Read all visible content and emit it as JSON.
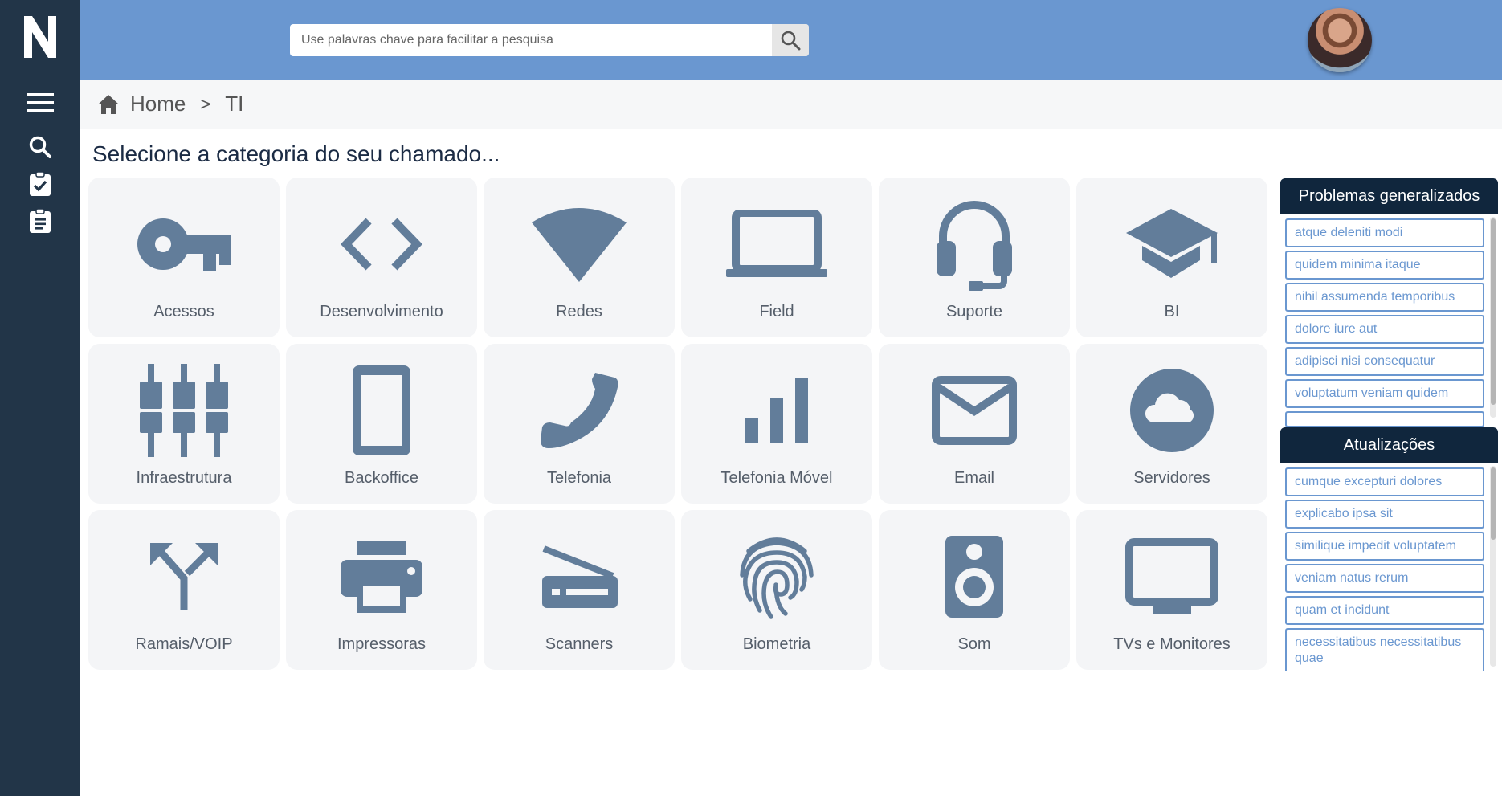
{
  "app": {
    "logo_letter": "N"
  },
  "sidebar": {
    "icons": [
      "menu-icon",
      "search-icon",
      "checklist-icon",
      "clipboard-icon"
    ]
  },
  "search": {
    "placeholder": "Use palavras chave para facilitar a pesquisa",
    "value": ""
  },
  "breadcrumb": {
    "home": "Home",
    "separator": ">",
    "current": "TI"
  },
  "page": {
    "title": "Selecione a categoria do seu chamado..."
  },
  "categories": [
    {
      "label": "Acessos",
      "icon": "key-icon"
    },
    {
      "label": "Desenvolvimento",
      "icon": "code-icon"
    },
    {
      "label": "Redes",
      "icon": "wifi-icon"
    },
    {
      "label": "Field",
      "icon": "laptop-icon"
    },
    {
      "label": "Suporte",
      "icon": "headset-icon"
    },
    {
      "label": "BI",
      "icon": "graduation-cap-icon"
    },
    {
      "label": "Infraestrutura",
      "icon": "plugs-icon"
    },
    {
      "label": "Backoffice",
      "icon": "tablet-icon"
    },
    {
      "label": "Telefonia",
      "icon": "phone-icon"
    },
    {
      "label": "Telefonia Móvel",
      "icon": "signal-bars-icon"
    },
    {
      "label": "Email",
      "icon": "envelope-icon"
    },
    {
      "label": "Servidores",
      "icon": "cloud-icon"
    },
    {
      "label": "Ramais/VOIP",
      "icon": "split-arrows-icon"
    },
    {
      "label": "Impressoras",
      "icon": "printer-icon"
    },
    {
      "label": "Scanners",
      "icon": "scanner-icon"
    },
    {
      "label": "Biometria",
      "icon": "fingerprint-icon"
    },
    {
      "label": "Som",
      "icon": "speaker-icon"
    },
    {
      "label": "TVs e Monitores",
      "icon": "tv-icon"
    }
  ],
  "problems": {
    "title": "Problemas generalizados",
    "items": [
      "atque deleniti modi",
      "quidem minima itaque",
      "nihil assumenda temporibus",
      "dolore iure aut",
      "adipisci nisi consequatur",
      "voluptatum veniam quidem"
    ]
  },
  "updates": {
    "title": "Atualizações",
    "items": [
      "cumque excepturi dolores",
      "explicabo ipsa sit",
      "similique impedit voluptatem",
      "veniam natus rerum",
      "quam et incidunt",
      "necessitatibus necessitatibus quae"
    ]
  },
  "colors": {
    "sidebar": "#223548",
    "topbar": "#6a97d0",
    "icon": "#627d9a",
    "panel_head": "#10263d",
    "link": "#6a97d0"
  }
}
